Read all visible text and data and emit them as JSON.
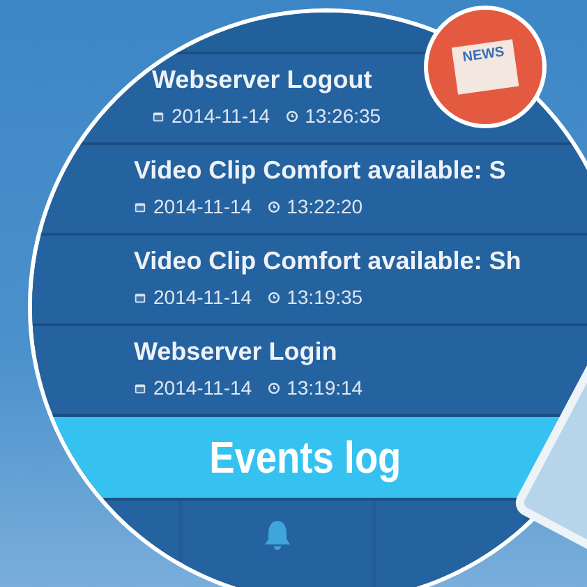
{
  "events": [
    {
      "title": "Webserver Logout",
      "date": "2014-11-14",
      "time": "13:26:35"
    },
    {
      "title": "Video Clip Comfort available: S",
      "date": "2014-11-14",
      "time": "13:22:20"
    },
    {
      "title": "Video Clip Comfort available: Sh",
      "date": "2014-11-14",
      "time": "13:19:35"
    },
    {
      "title": "Webserver Login",
      "date": "2014-11-14",
      "time": "13:19:14"
    }
  ],
  "banner": {
    "title": "Events log"
  },
  "badge": {
    "label": "NEWS"
  }
}
